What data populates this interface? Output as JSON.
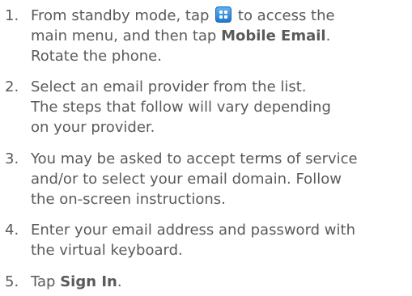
{
  "steps": [
    {
      "number": "1.",
      "line1_before": "From standby mode, tap",
      "menu_icon": "main-menu-grid-icon",
      "line1_after": "to access the",
      "line2_before": "main menu, and then tap",
      "line2_bold": "Mobile Email",
      "line2_after": ".",
      "line3": "Rotate the phone."
    },
    {
      "number": "2.",
      "lines": [
        "Select an email provider from the list.",
        "The steps that follow will vary depending",
        "on your provider."
      ]
    },
    {
      "number": "3.",
      "lines": [
        "You may be asked to accept terms of service",
        "and/or to select your email domain. Follow",
        "the on-screen instructions."
      ]
    },
    {
      "number": "4.",
      "lines": [
        "Enter your email address and password with",
        "the virtual keyboard."
      ]
    },
    {
      "number": "5.",
      "before": "Tap",
      "bold": "Sign In",
      "after": "."
    }
  ]
}
